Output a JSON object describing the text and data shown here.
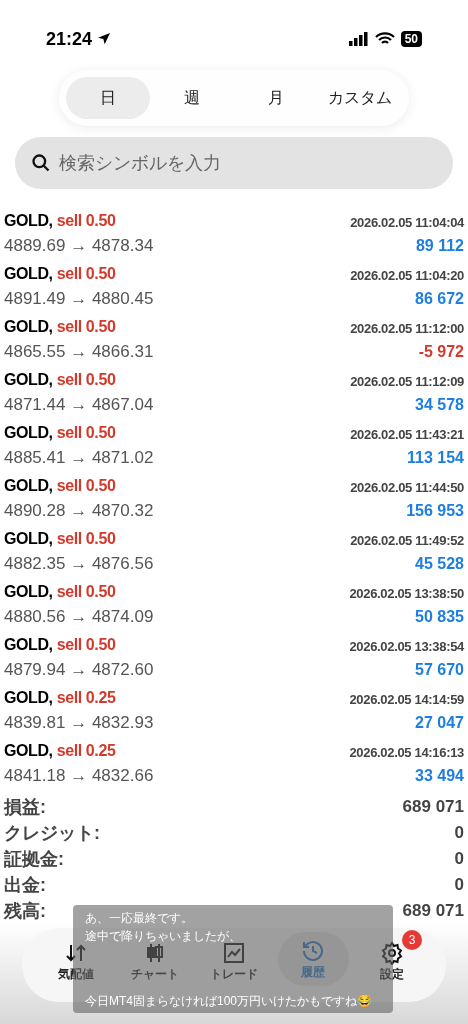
{
  "status_bar": {
    "time": "21:24",
    "battery": "50"
  },
  "period_tabs": [
    {
      "label": "日",
      "selected": true
    },
    {
      "label": "週",
      "selected": false
    },
    {
      "label": "月",
      "selected": false
    },
    {
      "label": "カスタム",
      "selected": false
    }
  ],
  "search": {
    "placeholder": "検索シンボルを入力"
  },
  "deals": [
    {
      "symbol": "GOLD,",
      "side": "sell 0.50",
      "time": "2026.02.05 11:04:04",
      "prices": "4889.69 → 4878.34",
      "profit": "89 112",
      "loss": false
    },
    {
      "symbol": "GOLD,",
      "side": "sell 0.50",
      "time": "2026.02.05 11:04:20",
      "prices": "4891.49 → 4880.45",
      "profit": "86 672",
      "loss": false
    },
    {
      "symbol": "GOLD,",
      "side": "sell 0.50",
      "time": "2026.02.05 11:12:00",
      "prices": "4865.55 → 4866.31",
      "profit": "-5 972",
      "loss": true
    },
    {
      "symbol": "GOLD,",
      "side": "sell 0.50",
      "time": "2026.02.05 11:12:09",
      "prices": "4871.44 → 4867.04",
      "profit": "34 578",
      "loss": false
    },
    {
      "symbol": "GOLD,",
      "side": "sell 0.50",
      "time": "2026.02.05 11:43:21",
      "prices": "4885.41 → 4871.02",
      "profit": "113 154",
      "loss": false
    },
    {
      "symbol": "GOLD,",
      "side": "sell 0.50",
      "time": "2026.02.05 11:44:50",
      "prices": "4890.28 → 4870.32",
      "profit": "156 953",
      "loss": false
    },
    {
      "symbol": "GOLD,",
      "side": "sell 0.50",
      "time": "2026.02.05 11:49:52",
      "prices": "4882.35 → 4876.56",
      "profit": "45 528",
      "loss": false
    },
    {
      "symbol": "GOLD,",
      "side": "sell 0.50",
      "time": "2026.02.05 13:38:50",
      "prices": "4880.56 → 4874.09",
      "profit": "50 835",
      "loss": false
    },
    {
      "symbol": "GOLD,",
      "side": "sell 0.50",
      "time": "2026.02.05 13:38:54",
      "prices": "4879.94 → 4872.60",
      "profit": "57 670",
      "loss": false
    },
    {
      "symbol": "GOLD,",
      "side": "sell 0.25",
      "time": "2026.02.05 14:14:59",
      "prices": "4839.81 → 4832.93",
      "profit": "27 047",
      "loss": false
    },
    {
      "symbol": "GOLD,",
      "side": "sell 0.25",
      "time": "2026.02.05 14:16:13",
      "prices": "4841.18 → 4832.66",
      "profit": "33 494",
      "loss": false
    }
  ],
  "summary": [
    {
      "label": "損益:",
      "value": "689 071"
    },
    {
      "label": "クレジット:",
      "value": "0"
    },
    {
      "label": "証拠金:",
      "value": "0"
    },
    {
      "label": "出金:",
      "value": "0"
    },
    {
      "label": "残高:",
      "value": "689 071"
    }
  ],
  "bottom_nav": [
    {
      "kind": "quotes",
      "label": "気配値",
      "selected": false
    },
    {
      "kind": "chart",
      "label": "チャート",
      "selected": false
    },
    {
      "kind": "trade",
      "label": "トレード",
      "selected": false
    },
    {
      "kind": "history",
      "label": "履歴",
      "selected": true
    },
    {
      "kind": "settings",
      "label": "設定",
      "selected": false,
      "badge": "3"
    }
  ],
  "caption": [
    "あ、一応最終です。",
    "途中で降りちゃいましたが、",
    "今日MT4固まらなければ100万円いけたかもですね😂"
  ]
}
